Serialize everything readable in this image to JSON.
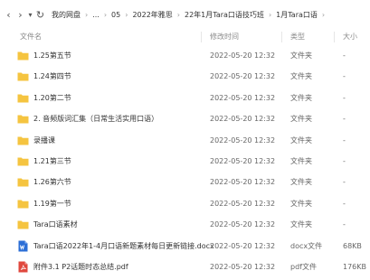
{
  "toolbar": {
    "back_glyph": "‹",
    "forward_glyph": "›",
    "dropdown_glyph": "▾",
    "refresh_glyph": "↻",
    "breadcrumbs": [
      "我的网盘",
      "...",
      "05",
      "2022年雅思",
      "22年1月Tara口语技巧班",
      "1月Tara口语"
    ],
    "separator": "›"
  },
  "columns": {
    "name": "文件名",
    "modified": "修改时间",
    "type": "类型",
    "size": "大小"
  },
  "files": [
    {
      "name": "1.25第五节",
      "modified": "2022-05-20 12:32",
      "type": "文件夹",
      "size": "-",
      "icon": "folder-icon"
    },
    {
      "name": "1.24第四节",
      "modified": "2022-05-20 12:32",
      "type": "文件夹",
      "size": "-",
      "icon": "folder-icon"
    },
    {
      "name": "1.20第二节",
      "modified": "2022-05-20 12:32",
      "type": "文件夹",
      "size": "-",
      "icon": "folder-icon"
    },
    {
      "name": "2. 音频版词汇集（日常生活实用口语）",
      "modified": "2022-05-20 12:32",
      "type": "文件夹",
      "size": "-",
      "icon": "folder-icon"
    },
    {
      "name": "录播课",
      "modified": "2022-05-20 12:32",
      "type": "文件夹",
      "size": "-",
      "icon": "folder-icon"
    },
    {
      "name": "1.21第三节",
      "modified": "2022-05-20 12:32",
      "type": "文件夹",
      "size": "-",
      "icon": "folder-icon"
    },
    {
      "name": "1.26第六节",
      "modified": "2022-05-20 12:32",
      "type": "文件夹",
      "size": "-",
      "icon": "folder-icon"
    },
    {
      "name": "1.19第一节",
      "modified": "2022-05-20 12:32",
      "type": "文件夹",
      "size": "-",
      "icon": "folder-icon"
    },
    {
      "name": "Tara口语素材",
      "modified": "2022-05-20 12:32",
      "type": "文件夹",
      "size": "-",
      "icon": "folder-icon"
    },
    {
      "name": "Tara口语2022年1-4月口语新题素材每日更新链接.docx",
      "modified": "2022-05-20 12:32",
      "type": "docx文件",
      "size": "68KB",
      "icon": "word-doc-icon"
    },
    {
      "name": "附件3.1 P2话题时态总结.pdf",
      "modified": "2022-05-20 12:32",
      "type": "pdf文件",
      "size": "176KB",
      "icon": "pdf-icon"
    }
  ],
  "colors": {
    "folder": "#f5c440",
    "word": "#2b6ed6",
    "pdf": "#e0483e",
    "accent": "#3b82f6"
  }
}
